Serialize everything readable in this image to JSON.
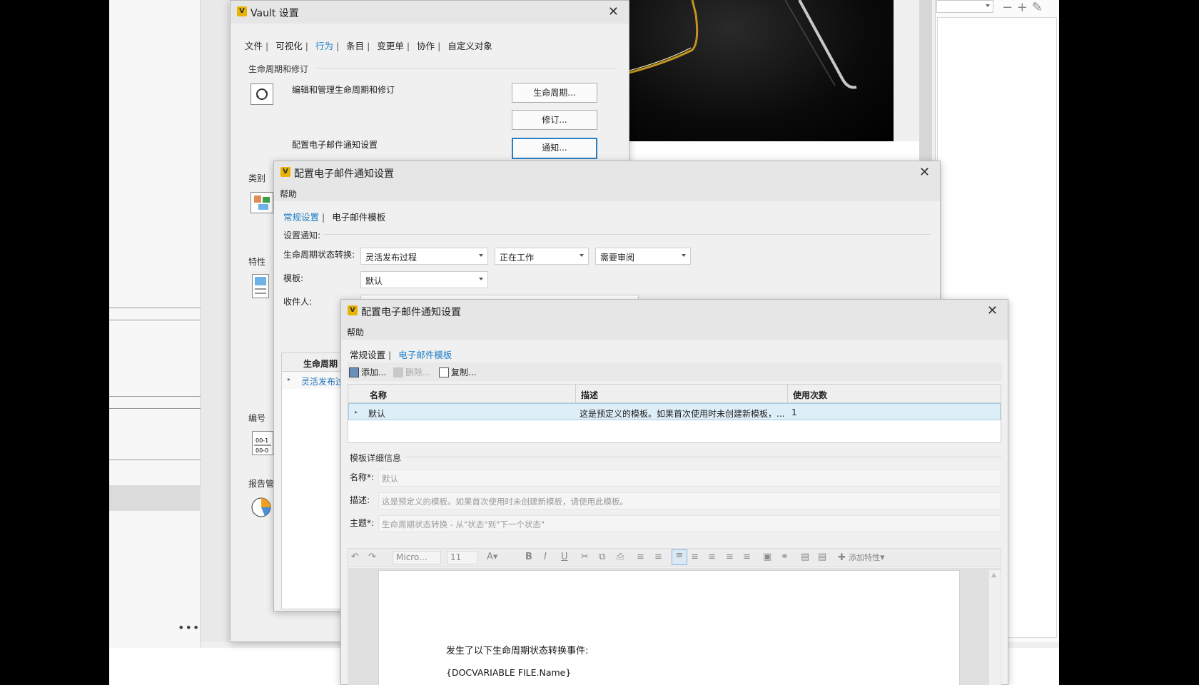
{
  "background": {
    "more_menu": "•••",
    "right_tools": "−  +  ✎"
  },
  "vault_dialog": {
    "title": "Vault 设置",
    "close_glyph": "✕",
    "tabs": [
      "文件",
      "可视化",
      "行为",
      "条目",
      "变更单",
      "协作",
      "自定义对象"
    ],
    "active_tab": "行为",
    "section_lifecycle": "生命周期和修订",
    "lifecycle_desc": "编辑和管理生命周期和修订",
    "lifecycle_button": "生命周期...",
    "revision_button": "修订...",
    "notify_desc": "配置电子邮件通知设置",
    "notify_button": "通知...",
    "section_category": "类别",
    "section_properties": "特性",
    "section_numbering": "编号",
    "section_reports": "报告管"
  },
  "notify_dialog": {
    "title": "配置电子邮件通知设置",
    "close_glyph": "✕",
    "menu_help": "帮助",
    "tab_general": "常规设置",
    "tab_templates": "电子邮件模板",
    "section_notify": "设置通知:",
    "label_transition": "生命周期状态转换:",
    "dd_process": "灵活发布过程",
    "dd_from": "正在工作",
    "dd_to": "需要审阅",
    "label_template": "模板:",
    "dd_template": "默认",
    "label_recipients": "收件人:",
    "grid_header": "生命周期",
    "grid_row": "灵活发布过"
  },
  "template_dialog": {
    "title": "配置电子邮件通知设置",
    "close_glyph": "✕",
    "menu_help": "帮助",
    "tab_general": "常规设置",
    "tab_templates": "电子邮件模板",
    "toolbar": {
      "add": "添加...",
      "delete": "删除...",
      "copy": "复制..."
    },
    "table": {
      "columns": [
        "名称",
        "描述",
        "使用次数"
      ],
      "rows": [
        {
          "name": "默认",
          "description": "这是预定义的模板。如果首次使用时未创建新模板，...",
          "count": "1"
        }
      ]
    },
    "details_section": "模板详细信息",
    "label_name": "名称*:",
    "value_name": "默认",
    "label_desc": "描述:",
    "value_desc": "这是预定义的模板。如果首次使用时未创建新模板，请使用此模板。",
    "label_subject": "主题*:",
    "value_subject": "生命周期状态转换 - 从\"状态\"到\"下一个状态\"",
    "format": {
      "font": "Micro...",
      "size": "11",
      "add_property": "添加特性"
    },
    "document": {
      "line1": "发生了以下生命周期状态转换事件:",
      "line2": "{DOCVARIABLE FILE.Name}"
    }
  }
}
